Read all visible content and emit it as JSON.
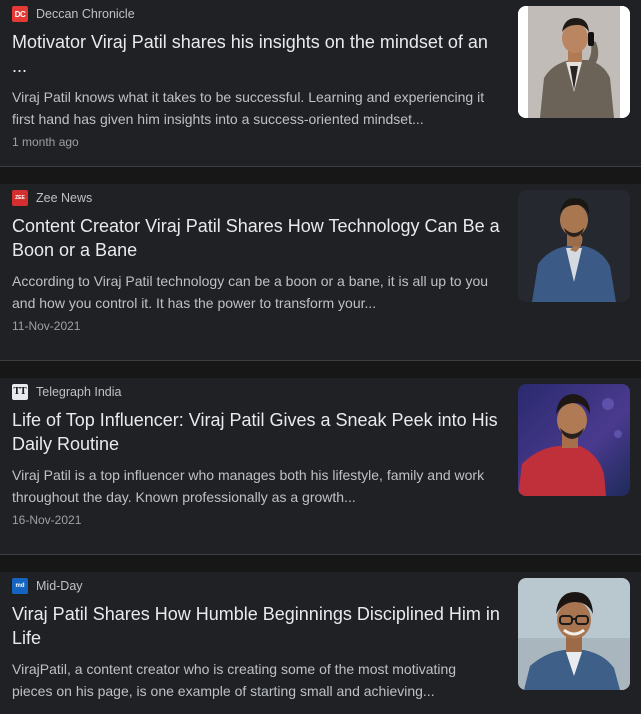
{
  "articles": [
    {
      "source": "Deccan Chronicle",
      "favicon": "DC",
      "headline": "Motivator Viraj Patil shares his insights on the mindset of an ...",
      "snippet": "Viraj Patil knows what it takes to be successful. Learning and experiencing it first hand has given him insights into a success-oriented mindset...",
      "date": "1 month ago",
      "thumbnail": "man-on-phone-photo"
    },
    {
      "source": "Zee News",
      "favicon": "ZEE",
      "headline": "Content Creator Viraj Patil Shares How Technology Can Be a Boon or a Bane",
      "snippet": "According to Viraj Patil technology can be a boon or a bane, it is all up to you and how you control it. It has the power to transform your...",
      "date": "11-Nov-2021",
      "thumbnail": "man-in-suit-photo"
    },
    {
      "source": "Telegraph India",
      "favicon": "TT",
      "headline": "Life of Top Influencer: Viraj Patil Gives a Sneak Peek into His Daily Routine",
      "snippet": "Viraj Patil is a top influencer who manages both his lifestyle, family and work throughout the day. Known professionally as a growth...",
      "date": "16-Nov-2021",
      "thumbnail": "man-in-red-shirt-photo"
    },
    {
      "source": "Mid-Day",
      "favicon": "md",
      "headline": "Viraj Patil Shares How Humble Beginnings Disciplined Him in Life",
      "snippet": "VirajPatil, a content creator who is creating some of the most motivating pieces on his page, is one example of starting small and achieving...",
      "date": "",
      "thumbnail": "man-with-glasses-photo"
    }
  ],
  "colors": {
    "background": "#202124",
    "divider": "#171717",
    "headline": "#e8eaed",
    "snippet": "#bdc1c6",
    "date": "#9aa0a6"
  }
}
